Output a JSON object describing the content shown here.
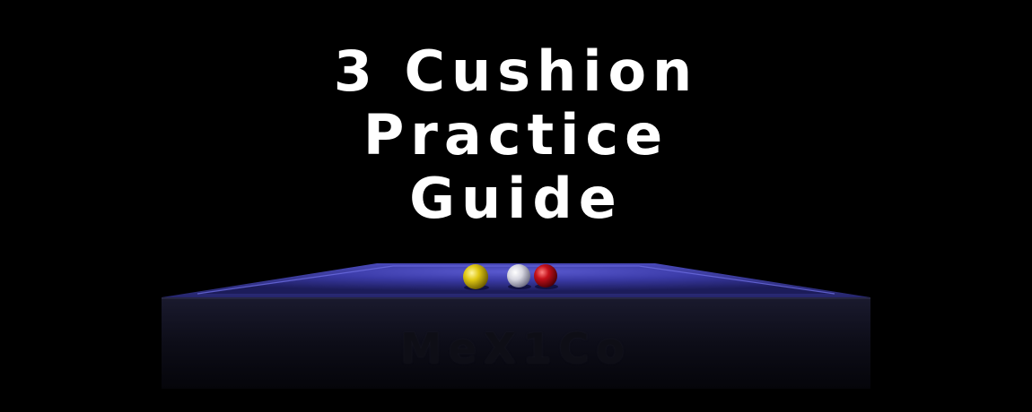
{
  "title": {
    "line1": "3 Cushion",
    "line2": "Practice",
    "line3": "Guide"
  },
  "table": {
    "brand_label": "MeX1Co",
    "cloth_color": "#3a3aa8",
    "balls": [
      {
        "name": "yellow-ball",
        "color": "#e8d21a"
      },
      {
        "name": "white-ball",
        "color": "#e6e6ee"
      },
      {
        "name": "red-ball",
        "color": "#c8101a"
      }
    ]
  }
}
